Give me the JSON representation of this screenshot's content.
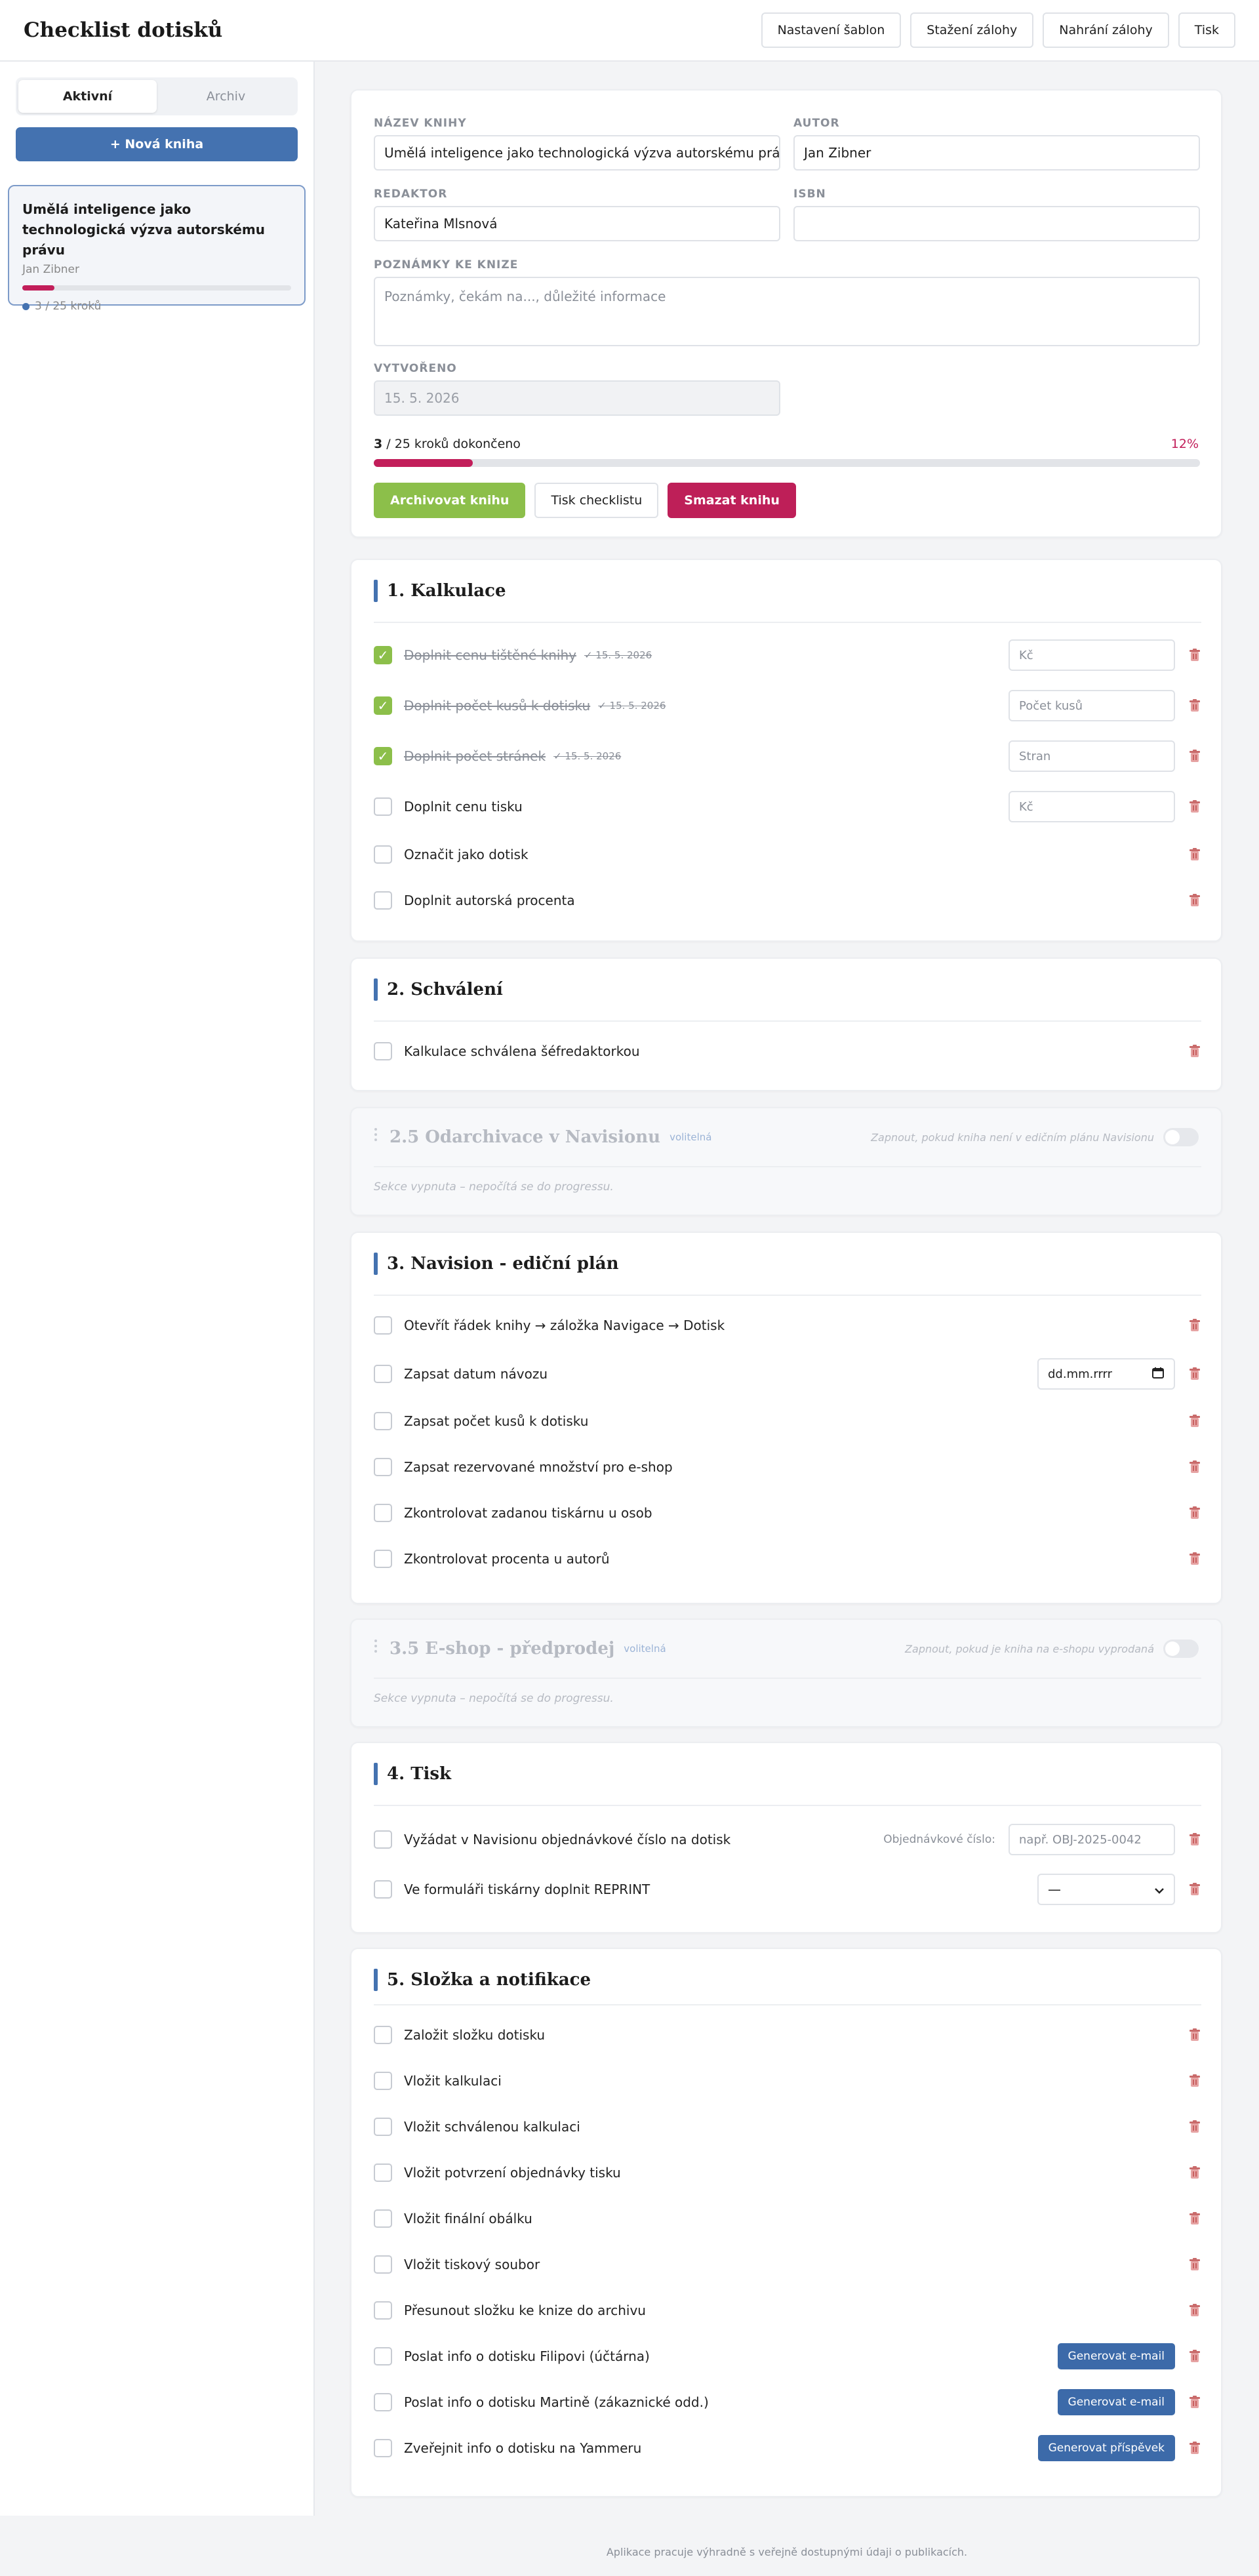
{
  "header": {
    "title": "Checklist dotisků",
    "actions": [
      "Nastavení šablon",
      "Stažení zálohy",
      "Nahrání zálohy",
      "Tisk"
    ]
  },
  "sidebar": {
    "tabs": [
      "Aktivní",
      "Archiv"
    ],
    "new_book": "+ Nová kniha",
    "book": {
      "title": "Umělá inteligence jako technologická výzva autorskému právu",
      "author": "Jan Zibner",
      "count": "3 / 25 kroků",
      "progress": 0.12
    }
  },
  "book_form": {
    "title_label": "Název knihy",
    "title_value": "Umělá inteligence jako technologická výzva autorskému právu",
    "author_label": "Autor",
    "author_value": "Jan Zibner",
    "editor_label": "Redaktor",
    "editor_value": "Kateřina Mlsnová",
    "isbn_label": "ISBN",
    "isbn_value": "",
    "notes_label": "Poznámky ke knize",
    "notes_placeholder": "Poznámky, čekám na..., důležité informace",
    "created_label": "Vytvořeno",
    "created_value": "15. 5. 2026",
    "progress_done": "3",
    "progress_text": " / 25 kroků dokončeno",
    "progress_percent": "12%",
    "progress": 0.12,
    "btn_archive": "Archivovat knihu",
    "btn_print": "Tisk checklistu",
    "btn_delete": "Smazat knihu"
  },
  "sections": {
    "kalkulace": {
      "title": "1. Kalkulace",
      "items": [
        {
          "label": "Doplnit cenu tištěné knihy",
          "done": true,
          "date": "✓ 15. 5. 2026",
          "placeholder": "Kč"
        },
        {
          "label": "Doplnit počet kusů k dotisku",
          "done": true,
          "date": "✓ 15. 5. 2026",
          "placeholder": "Počet kusů"
        },
        {
          "label": "Doplnit počet stránek",
          "done": true,
          "date": "✓ 15. 5. 2026",
          "placeholder": "Stran"
        },
        {
          "label": "Doplnit cenu tisku",
          "done": false,
          "placeholder": "Kč"
        },
        {
          "label": "Označit jako dotisk",
          "done": false
        },
        {
          "label": "Doplnit autorská procenta",
          "done": false
        }
      ]
    },
    "schvaleni": {
      "title": "2. Schválení",
      "items": [
        {
          "label": "Kalkulace schválena šéfredaktorkou"
        }
      ]
    },
    "odarchivace": {
      "title": "2.5 Odarchivace v Navisionu",
      "badge": "volitelná",
      "toggle_hint": "Zapnout, pokud kniha není v edičním plánu Navisionu",
      "note": "Sekce vypnuta – nepočítá se do progressu."
    },
    "navision": {
      "title": "3. Navision - ediční plán",
      "items": [
        {
          "label": "Otevřít řádek knihy → záložka Navigace → Dotisk"
        },
        {
          "label": "Zapsat datum návozu",
          "date_placeholder": "dd.mm.rrrr"
        },
        {
          "label": "Zapsat počet kusů k dotisku"
        },
        {
          "label": "Zapsat rezervované množství pro e-shop"
        },
        {
          "label": "Zkontrolovat zadanou tiskárnu u osob"
        },
        {
          "label": "Zkontrolovat procenta u autorů"
        }
      ]
    },
    "eshop": {
      "title": "3.5 E-shop - předprodej",
      "badge": "volitelná",
      "toggle_hint": "Zapnout, pokud je kniha na e-shopu vyprodaná",
      "note": "Sekce vypnuta – nepočítá se do progressu."
    },
    "tisk": {
      "title": "4. Tisk",
      "items": [
        {
          "label": "Vyžádat v Navisionu objednávkové číslo na dotisk",
          "field_label": "Objednávkové číslo:",
          "placeholder": "např. OBJ-2025-0042"
        },
        {
          "label": "Ve formuláři tiskárny doplnit REPRINT",
          "select_value": "—"
        }
      ]
    },
    "slozka": {
      "title": "5. Složka a notifikace",
      "items": [
        {
          "label": "Založit složku dotisku"
        },
        {
          "label": "Vložit kalkulaci"
        },
        {
          "label": "Vložit schválenou kalkulaci"
        },
        {
          "label": "Vložit potvrzení objednávky tisku"
        },
        {
          "label": "Vložit finální obálku"
        },
        {
          "label": "Vložit tiskový soubor"
        },
        {
          "label": "Přesunout složku ke knize do archivu"
        },
        {
          "label": "Poslat info o dotisku Filipovi (účtárna)",
          "action": "Generovat e-mail"
        },
        {
          "label": "Poslat info o dotisku Martině (zákaznické odd.)",
          "action": "Generovat e-mail"
        },
        {
          "label": "Zveřejnit info o dotisku na Yammeru",
          "action": "Generovat příspěvek"
        }
      ]
    }
  },
  "footer": "Aplikace pracuje výhradně s veřejně dostupnými údaji o publikacích.",
  "icons": {
    "trash": "trash-icon",
    "check": "check-icon",
    "calendar": "calendar-icon",
    "chevron": "chevron-down-icon",
    "grip": "drag-handle-icon"
  },
  "colors": {
    "accent": "#4472b0",
    "progress": "#c21e5a",
    "success": "#8cbf4a",
    "danger": "#be1f58"
  }
}
